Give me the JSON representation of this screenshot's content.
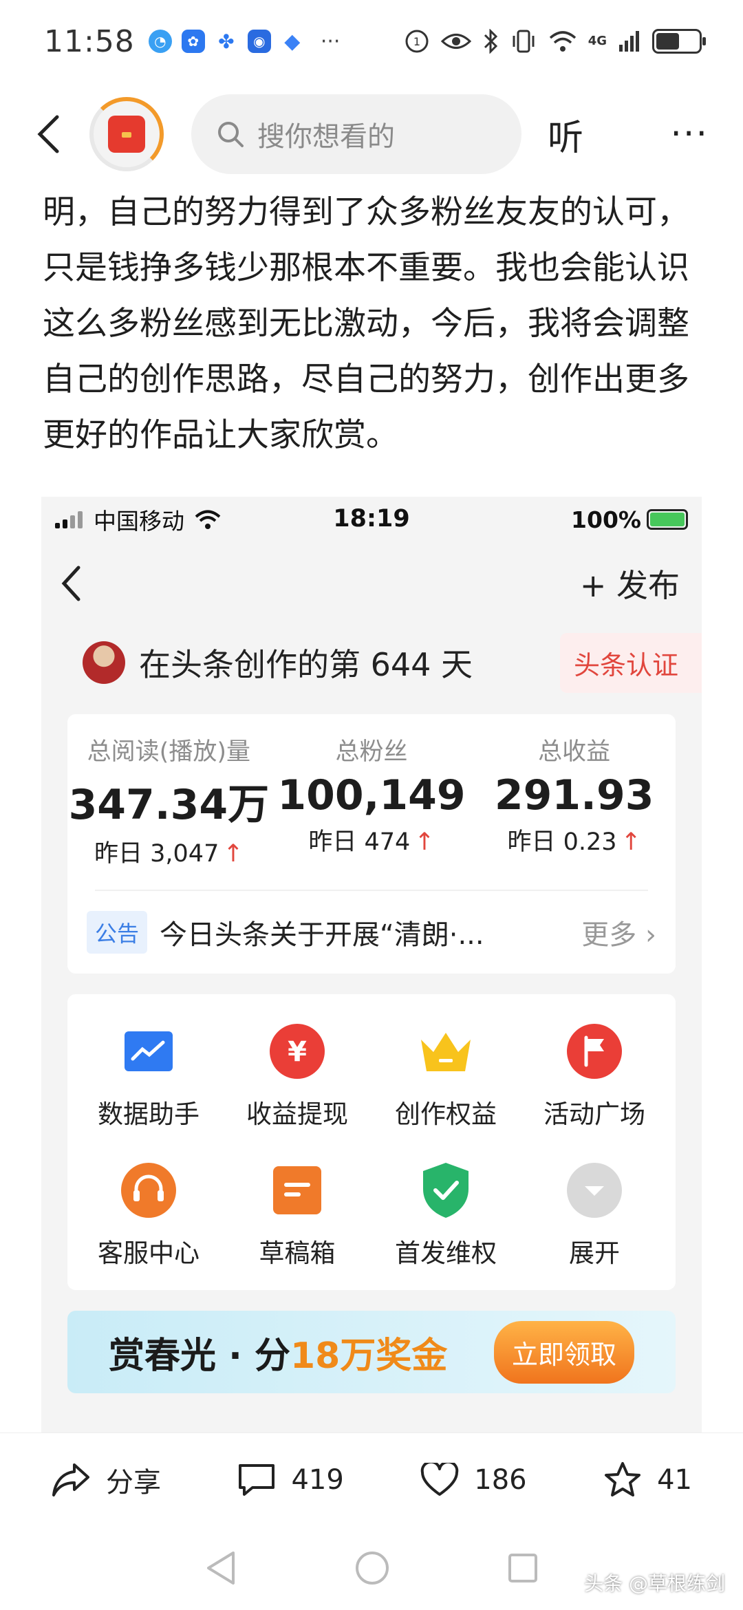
{
  "status_bar": {
    "time": "11:58",
    "dots": "···",
    "net_label": "4G"
  },
  "top_nav": {
    "search_placeholder": "搜你想看的",
    "listen_label": "听",
    "more_label": "···"
  },
  "article": {
    "text": "明，自己的努力得到了众多粉丝友友的认可，只是钱挣多钱少那根本不重要。我也会能认识这么多粉丝感到无比激动，今后，我将会调整自己的创作思路，尽自己的努力，创作出更多更好的作品让大家欣赏。"
  },
  "embedded": {
    "status": {
      "carrier": "中国移动",
      "time": "18:19",
      "battery": "100%"
    },
    "nav": {
      "publish": "+ 发布"
    },
    "creator": {
      "title": "在头条创作的第 644 天",
      "cert": "头条认证"
    },
    "stats": [
      {
        "label": "总阅读(播放)量",
        "value": "347.34万",
        "yday_label": "昨日",
        "yday_value": "3,047"
      },
      {
        "label": "总粉丝",
        "value": "100,149",
        "yday_label": "昨日",
        "yday_value": "474"
      },
      {
        "label": "总收益",
        "value": "291.93",
        "yday_label": "昨日",
        "yday_value": "0.23"
      }
    ],
    "notice": {
      "tag": "公告",
      "text": "今日头条关于开展“清朗·...",
      "more": "更多 ›"
    },
    "tools": [
      {
        "label": "数据助手",
        "icon": "chart-icon"
      },
      {
        "label": "收益提现",
        "icon": "yuan-icon"
      },
      {
        "label": "创作权益",
        "icon": "crown-icon"
      },
      {
        "label": "活动广场",
        "icon": "flag-icon"
      },
      {
        "label": "客服中心",
        "icon": "headset-icon"
      },
      {
        "label": "草稿箱",
        "icon": "draft-icon"
      },
      {
        "label": "首发维权",
        "icon": "shield-check-icon"
      },
      {
        "label": "展开",
        "icon": "expand-icon"
      }
    ],
    "banner": {
      "text_a": "赏春光 · 分",
      "text_hl": "18万奖金",
      "button": "立即领取"
    }
  },
  "actions": {
    "share": "分享",
    "comments": "419",
    "likes": "186",
    "favorites": "41"
  },
  "watermark": "头条 @草根练剑",
  "colors": {
    "accent_red": "#e1463d",
    "toutiao_blue": "#3b7ee5",
    "orange": "#f08a19"
  }
}
